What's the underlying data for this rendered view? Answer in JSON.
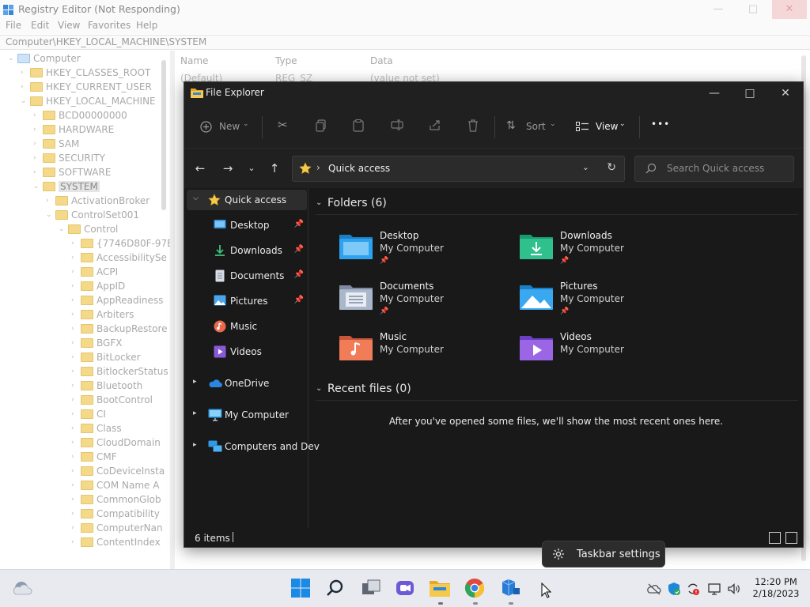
{
  "registry": {
    "title": "Registry Editor (Not Responding)",
    "menu": [
      "File",
      "Edit",
      "View",
      "Favorites",
      "Help"
    ],
    "path": "Computer\\HKEY_LOCAL_MACHINE\\SYSTEM",
    "tree": {
      "root": "Computer",
      "hives": [
        "HKEY_CLASSES_ROOT",
        "HKEY_CURRENT_USER",
        "HKEY_LOCAL_MACHINE"
      ],
      "hklm_children": [
        "BCD00000000",
        "HARDWARE",
        "SAM",
        "SECURITY",
        "SOFTWARE",
        "SYSTEM"
      ],
      "system_children": [
        "ActivationBroker",
        "ControlSet001"
      ],
      "controlset_children": [
        "Control"
      ],
      "control_children": [
        "{7746D80F-97E",
        "AccessibilitySe",
        "ACPI",
        "AppID",
        "AppReadiness",
        "Arbiters",
        "BackupRestore",
        "BGFX",
        "BitLocker",
        "BitlockerStatus",
        "Bluetooth",
        "BootControl",
        "CI",
        "Class",
        "CloudDomain",
        "CMF",
        "CoDeviceInsta",
        "COM Name A",
        "CommonGlob",
        "Compatibility",
        "ComputerNan",
        "ContentIndex"
      ]
    },
    "columns": [
      "Name",
      "Type",
      "Data"
    ],
    "rows": [
      {
        "name": "(Default)",
        "type": "REG_SZ",
        "data": "(value not set)"
      }
    ]
  },
  "explorer": {
    "title": "File Explorer",
    "toolbar": {
      "new": "New",
      "sort": "Sort",
      "view": "View",
      "more": "•••"
    },
    "address": "Quick access",
    "search_placeholder": "Search Quick access",
    "sidebar": {
      "quick_access": "Quick access",
      "pinned": [
        "Desktop",
        "Downloads",
        "Documents",
        "Pictures"
      ],
      "unpinned": [
        "Music",
        "Videos"
      ],
      "onedrive": "OneDrive",
      "my_computer": "My Computer",
      "network": "Computers and Dev"
    },
    "folders_header": "Folders (6)",
    "folders": [
      {
        "name": "Desktop",
        "location": "My Computer",
        "pinned": true,
        "icon": "desktop-folder-icon"
      },
      {
        "name": "Downloads",
        "location": "My Computer",
        "pinned": true,
        "icon": "downloads-folder-icon"
      },
      {
        "name": "Documents",
        "location": "My Computer",
        "pinned": true,
        "icon": "documents-folder-icon"
      },
      {
        "name": "Pictures",
        "location": "My Computer",
        "pinned": true,
        "icon": "pictures-folder-icon"
      },
      {
        "name": "Music",
        "location": "My Computer",
        "pinned": false,
        "icon": "music-folder-icon"
      },
      {
        "name": "Videos",
        "location": "My Computer",
        "pinned": false,
        "icon": "videos-folder-icon"
      }
    ],
    "recent_header": "Recent files (0)",
    "recent_empty": "After you've opened some files, we'll show the most recent ones here.",
    "status_count": "6 items"
  },
  "tooltip": {
    "label": "Taskbar settings"
  },
  "taskbar": {
    "time": "12:20 PM",
    "date": "2/18/2023",
    "apps": [
      "start-icon",
      "search-icon",
      "task-view-icon",
      "chat-icon",
      "file-explorer-icon",
      "chrome-icon",
      "registry-editor-icon"
    ]
  },
  "colors": {
    "explorer_bg": "#191919",
    "accent": "#0078d4",
    "folder_yellow": "#f5c94c"
  }
}
